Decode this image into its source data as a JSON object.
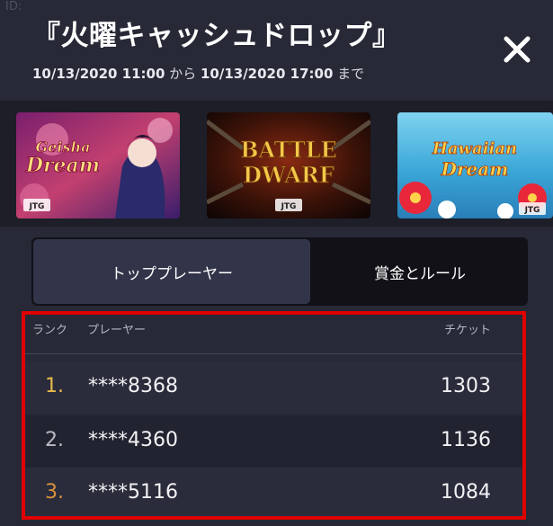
{
  "background": {
    "id_label": "ID:"
  },
  "header": {
    "title": "『火曜キャッシュドロップ』",
    "start": "10/13/2020 11:00",
    "from_word": " から ",
    "end": "10/13/2020 17:00",
    "until_word": " まで"
  },
  "games": [
    {
      "title_line1": "Geisha",
      "title_line2": "Dream",
      "icon": "game-thumbnail-geisha-dream",
      "badge": "JTG"
    },
    {
      "title_line1": "BATTLE",
      "title_line2": "DWARF",
      "icon": "game-thumbnail-battle-dwarf",
      "badge": "JTG"
    },
    {
      "title_line1": "Hawaiian",
      "title_line2": "Dream",
      "icon": "game-thumbnail-hawaiian-dream",
      "badge": "JTG"
    }
  ],
  "tabs": {
    "top_players": "トッププレーヤー",
    "prizes_rules": "賞金とルール",
    "active": "top_players"
  },
  "leaderboard": {
    "col_rank": "ランク",
    "col_player": "プレーヤー",
    "col_tickets": "チケット",
    "rows": [
      {
        "rank": "1.",
        "player": "****8368",
        "tickets": "1303"
      },
      {
        "rank": "2.",
        "player": "****4360",
        "tickets": "1136"
      },
      {
        "rank": "3.",
        "player": "****5116",
        "tickets": "1084"
      }
    ]
  },
  "colors": {
    "accent_highlight": "#e00000",
    "rank_gold": "#e6b94a",
    "rank_silver": "#b9bac4",
    "rank_bronze": "#d9923a",
    "panel": "#272937"
  }
}
